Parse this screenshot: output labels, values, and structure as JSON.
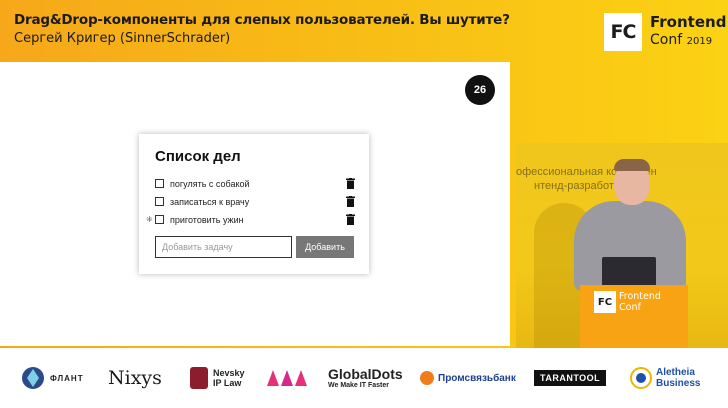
{
  "header": {
    "talk_title": "Drag&Drop-компоненты для слепых пользователей. Вы шутите?",
    "speaker": "Сергей Кригер (SinnerSchrader)",
    "logo_mark": "FC",
    "brand_name": "Frontend",
    "brand_sub": "Conf",
    "brand_year": "2019"
  },
  "slide": {
    "number": "26",
    "todo": {
      "title": "Список дел",
      "items": [
        {
          "label": "погулять с собакой",
          "checked": false
        },
        {
          "label": "записаться к врачу",
          "checked": false
        },
        {
          "label": "приготовить ужин",
          "checked": false
        }
      ],
      "input_placeholder": "Добавить задачу",
      "add_button": "Добавить"
    }
  },
  "video": {
    "banner_line1": "офессиональная конферен",
    "banner_line2": "нтенд-разработчиков",
    "podium_mark": "FC",
    "podium_brand1": "Frontend",
    "podium_brand2": "Conf"
  },
  "sponsors": {
    "flant": "ФЛАНТ",
    "nixys": "Nixys",
    "nevsky_line1": "Nevsky",
    "nevsky_line2": "IP Law",
    "globaldots_name": "GlobalDots",
    "globaldots_tag": "We Make IT Faster",
    "psb": "Промсвязьбанк",
    "tarantool": "TARANTOOL",
    "aletheia_line1": "Aletheia",
    "aletheia_line2": "Business"
  },
  "colors": {
    "accent_orange": "#f6a81a",
    "accent_yellow": "#fbd214",
    "button_gray": "#777777"
  }
}
